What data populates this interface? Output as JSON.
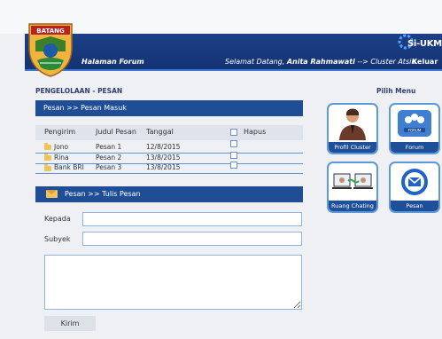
{
  "header": {
    "logo_text": "BATANG",
    "page_title": "Halaman Forum",
    "welcome_prefix": "Selamat Datang,",
    "user_name": "Anita Rahmawati",
    "welcome_suffix": "--> Cluster Atsiri",
    "logout_label": "Keluar",
    "brand": "Si-UKM"
  },
  "main": {
    "section_title": "PENGELOLAAN - PESAN",
    "inbox_title": "Pesan >> Pesan Masuk",
    "compose_title": "Pesan >> Tulis Pesan",
    "columns": [
      "Pengirim",
      "Judul Pesan",
      "Tanggal",
      "Hapus"
    ],
    "rows": [
      {
        "sender": "Jono",
        "subject": "Pesan 1",
        "date": "12/8/2015"
      },
      {
        "sender": "Rina",
        "subject": "Pesan 2",
        "date": "13/8/2015"
      },
      {
        "sender": "Bank BRI",
        "subject": "Pesan 3",
        "date": "13/8/2015"
      }
    ],
    "form": {
      "to_label": "Kepada",
      "subject_label": "Subyek",
      "to_value": "",
      "subject_value": "",
      "message_value": "",
      "send_label": "Kirim"
    }
  },
  "menu": {
    "title": "Pilih Menu",
    "items": [
      {
        "label": "Profil Cluster",
        "icon": "person-icon"
      },
      {
        "label": "Forum",
        "icon": "forum-icon"
      },
      {
        "label": "Ruang Chating",
        "icon": "chat-icon"
      },
      {
        "label": "Pesan",
        "icon": "mail-icon"
      }
    ]
  },
  "colors": {
    "header_bar": "#1c3f86",
    "section_bar": "#1f4e96",
    "tile_border": "#5b9ad6"
  }
}
